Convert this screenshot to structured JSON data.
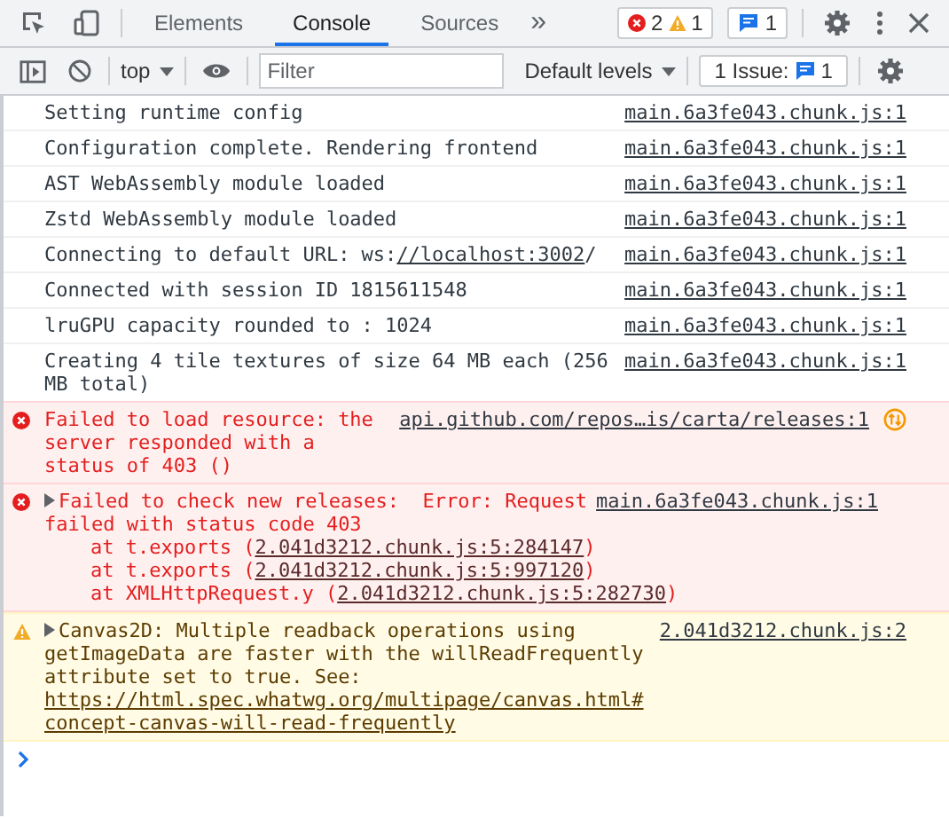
{
  "tabs": [
    {
      "label": "Elements",
      "selected": false
    },
    {
      "label": "Console",
      "selected": true
    },
    {
      "label": "Sources",
      "selected": false
    }
  ],
  "more_tabs": "»",
  "counters": {
    "errors": "2",
    "warnings": "1",
    "messages": "1"
  },
  "console_toolbar": {
    "context": "top",
    "filter": {
      "placeholder": "Filter"
    },
    "levels": "Default levels",
    "issues": {
      "label": "1 Issue:",
      "count": "1"
    }
  },
  "messages": [
    {
      "kind": "log",
      "parts": [
        {
          "text": "Setting runtime config"
        }
      ],
      "source": "main.6a3fe043.chunk.js:1"
    },
    {
      "kind": "log",
      "parts": [
        {
          "text": "Configuration complete. Rendering frontend"
        }
      ],
      "source": "main.6a3fe043.chunk.js:1"
    },
    {
      "kind": "log",
      "parts": [
        {
          "text": "AST WebAssembly module loaded"
        }
      ],
      "source": "main.6a3fe043.chunk.js:1"
    },
    {
      "kind": "log",
      "parts": [
        {
          "text": "Zstd WebAssembly module loaded"
        }
      ],
      "source": "main.6a3fe043.chunk.js:1"
    },
    {
      "kind": "log",
      "parts": [
        {
          "text": "Connecting to default URL: ws:"
        },
        {
          "text": "//localhost:3002",
          "link": true
        },
        {
          "text": "/"
        }
      ],
      "source": "main.6a3fe043.chunk.js:1"
    },
    {
      "kind": "log",
      "parts": [
        {
          "text": "Connected with session ID 1815611548"
        }
      ],
      "source": "main.6a3fe043.chunk.js:1"
    },
    {
      "kind": "log",
      "parts": [
        {
          "text": "lruGPU capacity rounded to : 1024"
        }
      ],
      "source": "main.6a3fe043.chunk.js:1"
    },
    {
      "kind": "log",
      "parts": [
        {
          "text": "Creating 4 tile textures of size 64 MB each (256 MB total)"
        }
      ],
      "source": "main.6a3fe043.chunk.js:1"
    },
    {
      "kind": "error",
      "parts": [
        {
          "text": "Failed to load resource: the server responded with a status of 403 ()"
        }
      ],
      "source": "api.github.com/repos…is/carta/releases:1",
      "network_request": true
    },
    {
      "kind": "error",
      "expanded": false,
      "parts": [
        {
          "text": "Failed to check new releases:  Error: Request failed with status code 403"
        }
      ],
      "source": "main.6a3fe043.chunk.js:1",
      "stack": [
        {
          "prefix": "at t.exports (",
          "link": "2.041d3212.chunk.js:5:284147",
          "suffix": ")"
        },
        {
          "prefix": "at t.exports (",
          "link": "2.041d3212.chunk.js:5:997120",
          "suffix": ")"
        },
        {
          "prefix": "at XMLHttpRequest.y (",
          "link": "2.041d3212.chunk.js:5:282730",
          "suffix": ")"
        }
      ]
    },
    {
      "kind": "warning",
      "expanded": false,
      "parts": [
        {
          "text": "Canvas2D: Multiple readback operations using getImageData are faster with the willReadFrequently attribute set to true. See: "
        },
        {
          "text": "https://html.spec.whatwg.org/multipage/canvas.html#concept-canvas-will-read-frequently",
          "link": true
        }
      ],
      "source": "2.041d3212.chunk.js:2"
    }
  ]
}
